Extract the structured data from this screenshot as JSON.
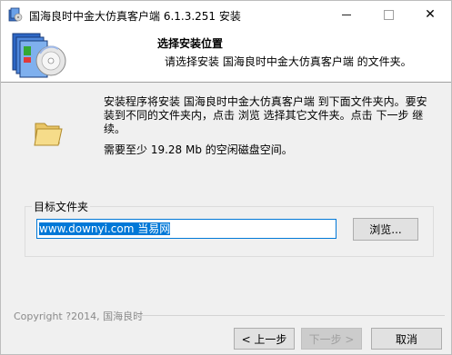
{
  "window": {
    "title": "国海良时中金大仿真客户端 6.1.3.251 安装",
    "icon": "installer-app-icon",
    "controls": {
      "minimize_icon": "minimize-icon",
      "maximize_icon": "maximize-icon",
      "close_icon": "close-icon",
      "close_glyph": "✕"
    }
  },
  "header": {
    "title": "选择安装位置",
    "subtitle": "请选择安装 国海良时中金大仿真客户端 的文件夹。",
    "graphic": "installer-disc-icon"
  },
  "body": {
    "folder_icon": "folder-icon",
    "description": "安装程序将安装 国海良时中金大仿真客户端 到下面文件夹内。要安装到不同的文件夹内，点击 浏览 选择其它文件夹。点击 下一步 继续。",
    "space_required": "需要至少 19.28 Mb 的空闲磁盘空间。"
  },
  "destination": {
    "group_label": "目标文件夹",
    "path_value": "www.downyi.com 当易网",
    "browse_label": "浏览..."
  },
  "footer": {
    "copyright": "Copyright ?2014, 国海良时",
    "back_label": "< 上一步",
    "next_label": "下一步 >",
    "cancel_label": "取消"
  },
  "colors": {
    "accent": "#0078d7",
    "dialog_bg": "#f0f0f0"
  }
}
